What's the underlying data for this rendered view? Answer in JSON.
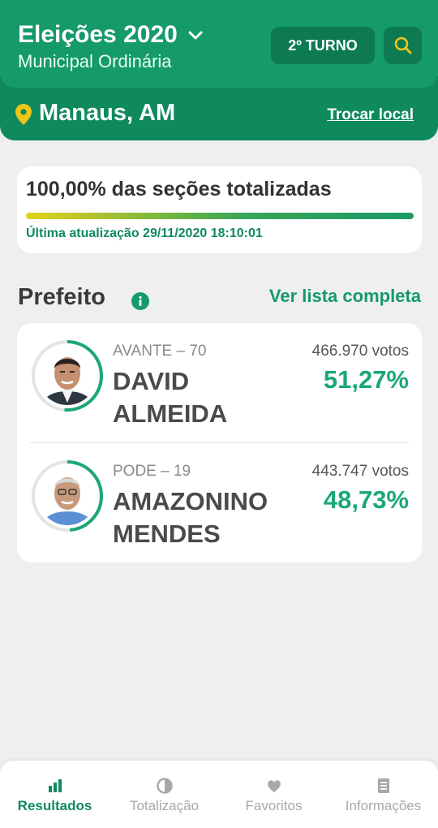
{
  "header": {
    "title": "Eleições 2020",
    "subtitle": "Municipal Ordinária",
    "turno_label": "2º TURNO"
  },
  "location": {
    "city": "Manaus, AM",
    "change_label": "Trocar local"
  },
  "progress": {
    "title": "100,00% das seções totalizadas",
    "percent": 100,
    "updated": "Última atualização 29/11/2020 18:10:01"
  },
  "section": {
    "title": "Prefeito",
    "link": "Ver lista completa"
  },
  "candidates": [
    {
      "party": "AVANTE – 70",
      "name": "DAVID ALMEIDA",
      "votes": "466.970 votos",
      "percent_label": "51,27%",
      "percent": 51.27
    },
    {
      "party": "PODE – 19",
      "name": "AMAZONINO MENDES",
      "votes": "443.747 votos",
      "percent_label": "48,73%",
      "percent": 48.73
    }
  ],
  "nav": {
    "items": [
      {
        "label": "Resultados",
        "icon": "bar-chart-icon",
        "active": true
      },
      {
        "label": "Totalização",
        "icon": "pie-chart-icon",
        "active": false
      },
      {
        "label": "Favoritos",
        "icon": "heart-icon",
        "active": false
      },
      {
        "label": "Informações",
        "icon": "document-icon",
        "active": false
      }
    ]
  },
  "colors": {
    "primary": "#159a6a",
    "dark": "#0f8a5d",
    "accent": "#1aa874",
    "pin": "#f0c419"
  }
}
